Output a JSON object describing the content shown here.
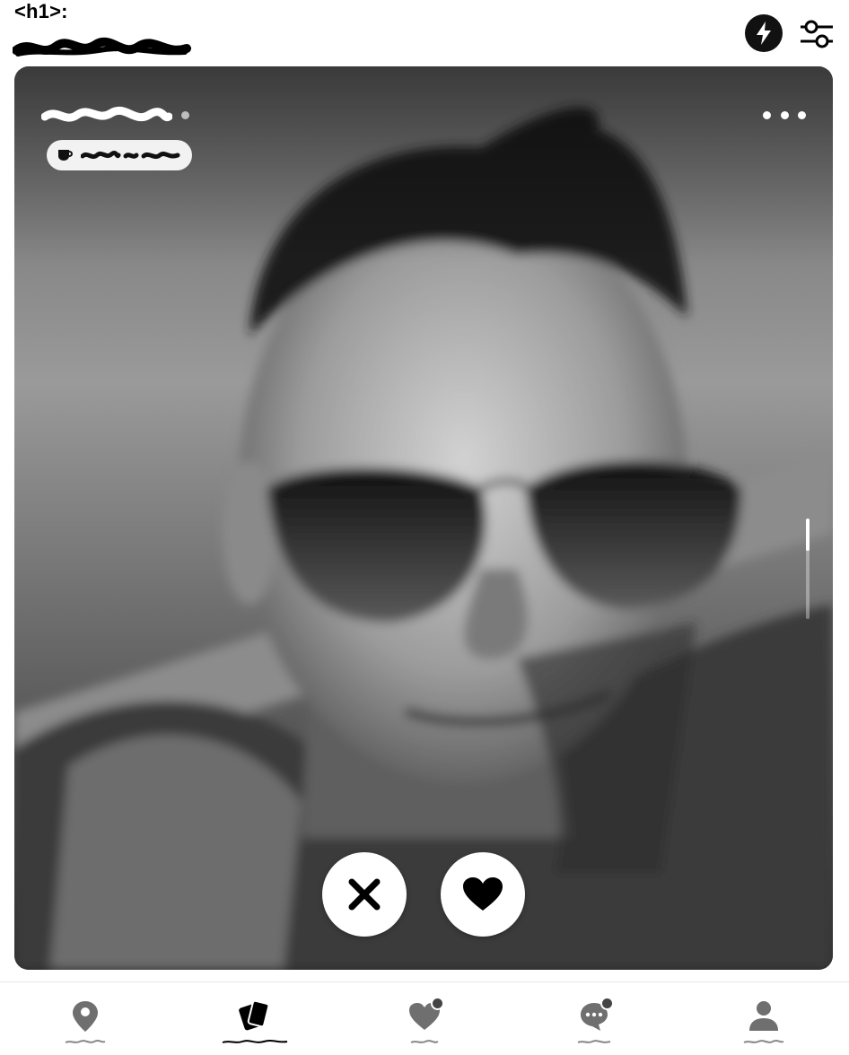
{
  "header": {
    "h1_label": "<h1>:"
  },
  "icons": {
    "boost": "lightning-icon",
    "filters": "sliders-icon",
    "more": "more-horizontal-icon",
    "coffee": "coffee-icon",
    "pass": "close-icon",
    "like": "heart-icon"
  },
  "profile_card": {
    "photo_fraction_scrolled": 0
  },
  "bottom_nav": {
    "items": [
      {
        "icon": "location-pin-icon",
        "active": false,
        "badge": false
      },
      {
        "icon": "cards-icon",
        "active": true,
        "badge": false
      },
      {
        "icon": "heart-icon",
        "active": false,
        "badge": true
      },
      {
        "icon": "chat-icon",
        "active": false,
        "badge": true
      },
      {
        "icon": "profile-icon",
        "active": false,
        "badge": false
      }
    ]
  },
  "colors": {
    "accent": "#111111",
    "inactive_icon": "#6f6f6f",
    "badge": "#444444"
  }
}
